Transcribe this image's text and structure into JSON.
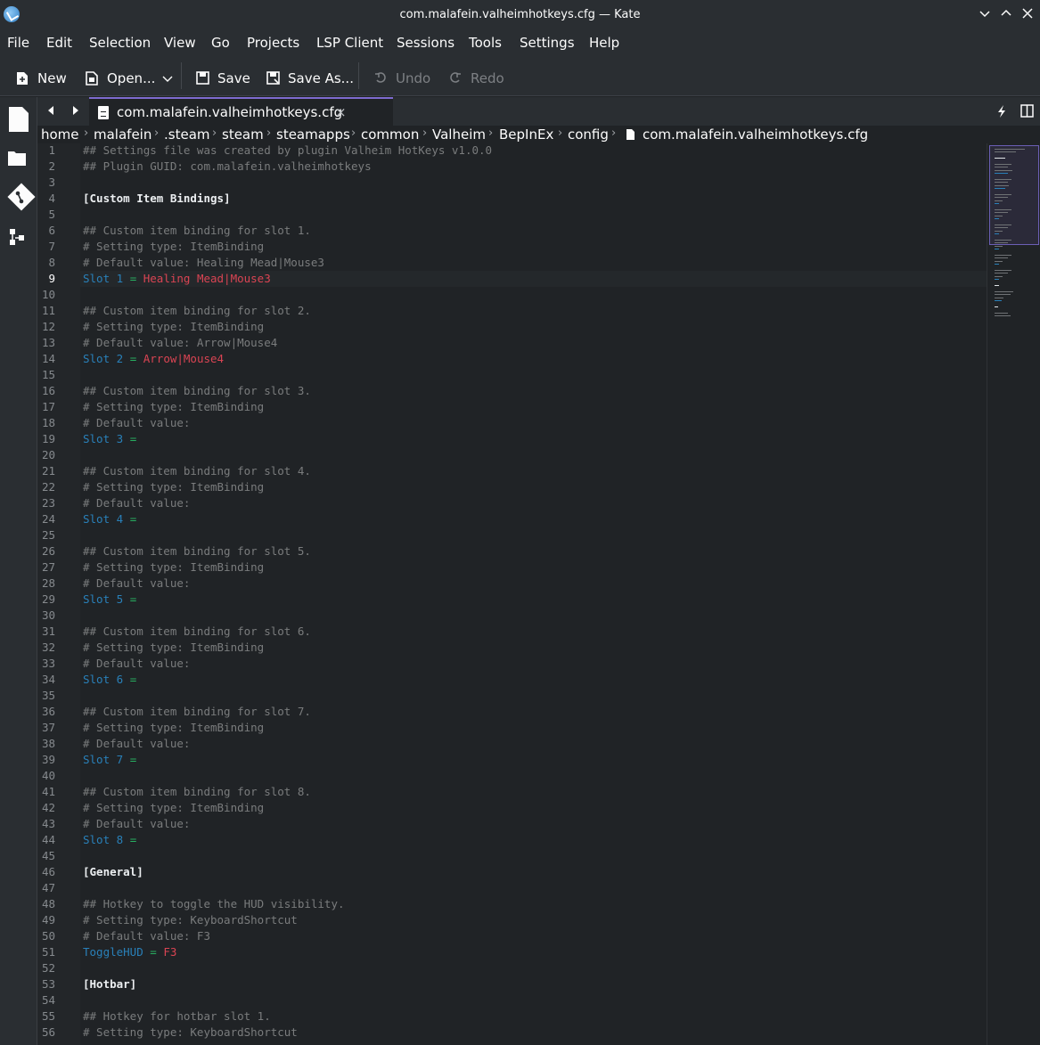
{
  "window": {
    "title": "com.malafein.valheimhotkeys.cfg — Kate"
  },
  "menubar": {
    "items": [
      "File",
      "Edit",
      "Selection",
      "View",
      "Go",
      "Projects",
      "LSP Client",
      "Sessions",
      "Tools",
      "Settings",
      "Help"
    ]
  },
  "toolbar": {
    "new_label": "New",
    "open_label": "Open...",
    "save_label": "Save",
    "save_as_label": "Save As...",
    "undo_label": "Undo",
    "redo_label": "Redo"
  },
  "tab": {
    "label": "com.malafein.valheimhotkeys.cfg",
    "close_glyph": "×"
  },
  "breadcrumb": [
    "home",
    "malafein",
    ".steam",
    "steam",
    "steamapps",
    "common",
    "Valheim",
    "BepInEx",
    "config",
    "com.malafein.valheimhotkeys.cfg"
  ],
  "editor": {
    "current_line": 9,
    "lines": [
      {
        "n": "1",
        "t": "comment",
        "text": "## Settings file was created by plugin Valheim HotKeys v1.0.0"
      },
      {
        "n": "2",
        "t": "comment",
        "text": "## Plugin GUID: com.malafein.valheimhotkeys"
      },
      {
        "n": "3",
        "t": "blank",
        "text": ""
      },
      {
        "n": "4",
        "t": "section",
        "text": "[Custom Item Bindings]"
      },
      {
        "n": "5",
        "t": "blank",
        "text": ""
      },
      {
        "n": "6",
        "t": "comment",
        "text": "## Custom item binding for slot 1."
      },
      {
        "n": "7",
        "t": "comment",
        "text": "# Setting type: ItemBinding"
      },
      {
        "n": "8",
        "t": "comment",
        "text": "# Default value: Healing Mead|Mouse3"
      },
      {
        "n": "9",
        "t": "kv",
        "key": "Slot 1",
        "eq": "=",
        "val": "Healing Mead|Mouse3"
      },
      {
        "n": "10",
        "t": "blank",
        "text": ""
      },
      {
        "n": "11",
        "t": "comment",
        "text": "## Custom item binding for slot 2."
      },
      {
        "n": "12",
        "t": "comment",
        "text": "# Setting type: ItemBinding"
      },
      {
        "n": "13",
        "t": "comment",
        "text": "# Default value: Arrow|Mouse4"
      },
      {
        "n": "14",
        "t": "kv",
        "key": "Slot 2",
        "eq": "=",
        "val": "Arrow|Mouse4"
      },
      {
        "n": "15",
        "t": "blank",
        "text": ""
      },
      {
        "n": "16",
        "t": "comment",
        "text": "## Custom item binding for slot 3."
      },
      {
        "n": "17",
        "t": "comment",
        "text": "# Setting type: ItemBinding"
      },
      {
        "n": "18",
        "t": "comment",
        "text": "# Default value:"
      },
      {
        "n": "19",
        "t": "kv",
        "key": "Slot 3",
        "eq": "=",
        "val": ""
      },
      {
        "n": "20",
        "t": "blank",
        "text": ""
      },
      {
        "n": "21",
        "t": "comment",
        "text": "## Custom item binding for slot 4."
      },
      {
        "n": "22",
        "t": "comment",
        "text": "# Setting type: ItemBinding"
      },
      {
        "n": "23",
        "t": "comment",
        "text": "# Default value:"
      },
      {
        "n": "24",
        "t": "kv",
        "key": "Slot 4",
        "eq": "=",
        "val": ""
      },
      {
        "n": "25",
        "t": "blank",
        "text": ""
      },
      {
        "n": "26",
        "t": "comment",
        "text": "## Custom item binding for slot 5."
      },
      {
        "n": "27",
        "t": "comment",
        "text": "# Setting type: ItemBinding"
      },
      {
        "n": "28",
        "t": "comment",
        "text": "# Default value:"
      },
      {
        "n": "29",
        "t": "kv",
        "key": "Slot 5",
        "eq": "=",
        "val": ""
      },
      {
        "n": "30",
        "t": "blank",
        "text": ""
      },
      {
        "n": "31",
        "t": "comment",
        "text": "## Custom item binding for slot 6."
      },
      {
        "n": "32",
        "t": "comment",
        "text": "# Setting type: ItemBinding"
      },
      {
        "n": "33",
        "t": "comment",
        "text": "# Default value:"
      },
      {
        "n": "34",
        "t": "kv",
        "key": "Slot 6",
        "eq": "=",
        "val": ""
      },
      {
        "n": "35",
        "t": "blank",
        "text": ""
      },
      {
        "n": "36",
        "t": "comment",
        "text": "## Custom item binding for slot 7."
      },
      {
        "n": "37",
        "t": "comment",
        "text": "# Setting type: ItemBinding"
      },
      {
        "n": "38",
        "t": "comment",
        "text": "# Default value:"
      },
      {
        "n": "39",
        "t": "kv",
        "key": "Slot 7",
        "eq": "=",
        "val": ""
      },
      {
        "n": "40",
        "t": "blank",
        "text": ""
      },
      {
        "n": "41",
        "t": "comment",
        "text": "## Custom item binding for slot 8."
      },
      {
        "n": "42",
        "t": "comment",
        "text": "# Setting type: ItemBinding"
      },
      {
        "n": "43",
        "t": "comment",
        "text": "# Default value:"
      },
      {
        "n": "44",
        "t": "kv",
        "key": "Slot 8",
        "eq": "=",
        "val": ""
      },
      {
        "n": "45",
        "t": "blank",
        "text": ""
      },
      {
        "n": "46",
        "t": "section",
        "text": "[General]"
      },
      {
        "n": "47",
        "t": "blank",
        "text": ""
      },
      {
        "n": "48",
        "t": "comment",
        "text": "## Hotkey to toggle the HUD visibility."
      },
      {
        "n": "49",
        "t": "comment",
        "text": "# Setting type: KeyboardShortcut"
      },
      {
        "n": "50",
        "t": "comment",
        "text": "# Default value: F3"
      },
      {
        "n": "51",
        "t": "kv",
        "key": "ToggleHUD",
        "eq": "=",
        "val": "F3"
      },
      {
        "n": "52",
        "t": "blank",
        "text": ""
      },
      {
        "n": "53",
        "t": "section",
        "text": "[Hotbar]"
      },
      {
        "n": "54",
        "t": "blank",
        "text": ""
      },
      {
        "n": "55",
        "t": "comment",
        "text": "## Hotkey for hotbar slot 1."
      },
      {
        "n": "56",
        "t": "comment",
        "text": "# Setting type: KeyboardShortcut"
      }
    ]
  },
  "colors": {
    "comment": "#7a7c7d",
    "key": "#2980b9",
    "equals": "#27ae60",
    "value": "#da4453",
    "accent": "#7e6bd0"
  }
}
